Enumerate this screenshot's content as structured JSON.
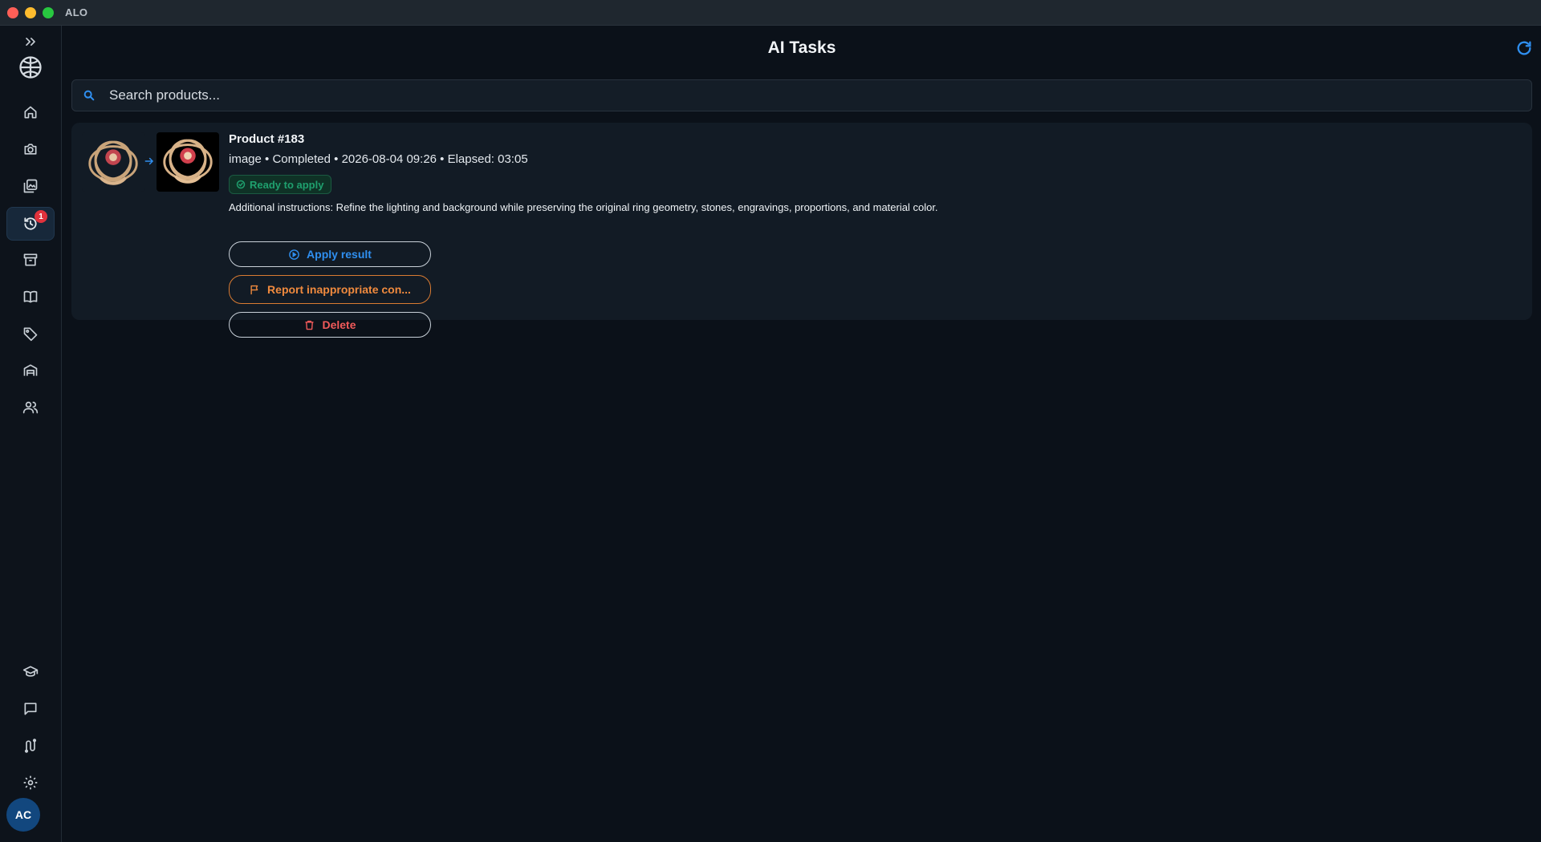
{
  "window": {
    "app_title": "ALO"
  },
  "sidebar": {
    "items": [
      {
        "name": "expand-icon"
      },
      {
        "name": "world-icon"
      },
      {
        "name": "home-icon"
      },
      {
        "name": "camera-icon"
      },
      {
        "name": "gallery-icon"
      },
      {
        "name": "history-icon",
        "active": true,
        "badge": "1"
      },
      {
        "name": "archive-icon"
      },
      {
        "name": "book-icon"
      },
      {
        "name": "tag-icon"
      },
      {
        "name": "warehouse-icon"
      },
      {
        "name": "users-icon"
      },
      {
        "name": "school-icon"
      },
      {
        "name": "chat-icon"
      },
      {
        "name": "route-icon"
      },
      {
        "name": "gear-icon"
      }
    ],
    "avatar": "AC"
  },
  "header": {
    "title": "AI Tasks"
  },
  "search": {
    "placeholder": "Search products..."
  },
  "task": {
    "title": "Product #183",
    "meta": "image • Completed • 2026-08-04 09:26 • Elapsed: 03:05",
    "status": "Ready to apply",
    "instructions": "Additional instructions: Refine the lighting and background while preserving the original ring geometry, stones, engravings, proportions, and material color.",
    "apply_label": "Apply result",
    "report_label": "Report inappropriate con...",
    "delete_label": "Delete"
  },
  "colors": {
    "accent": "#2f8ff0",
    "success": "#1fa06e",
    "warning": "#f08a3e",
    "danger": "#f25a5a",
    "background": "#0b1119"
  }
}
